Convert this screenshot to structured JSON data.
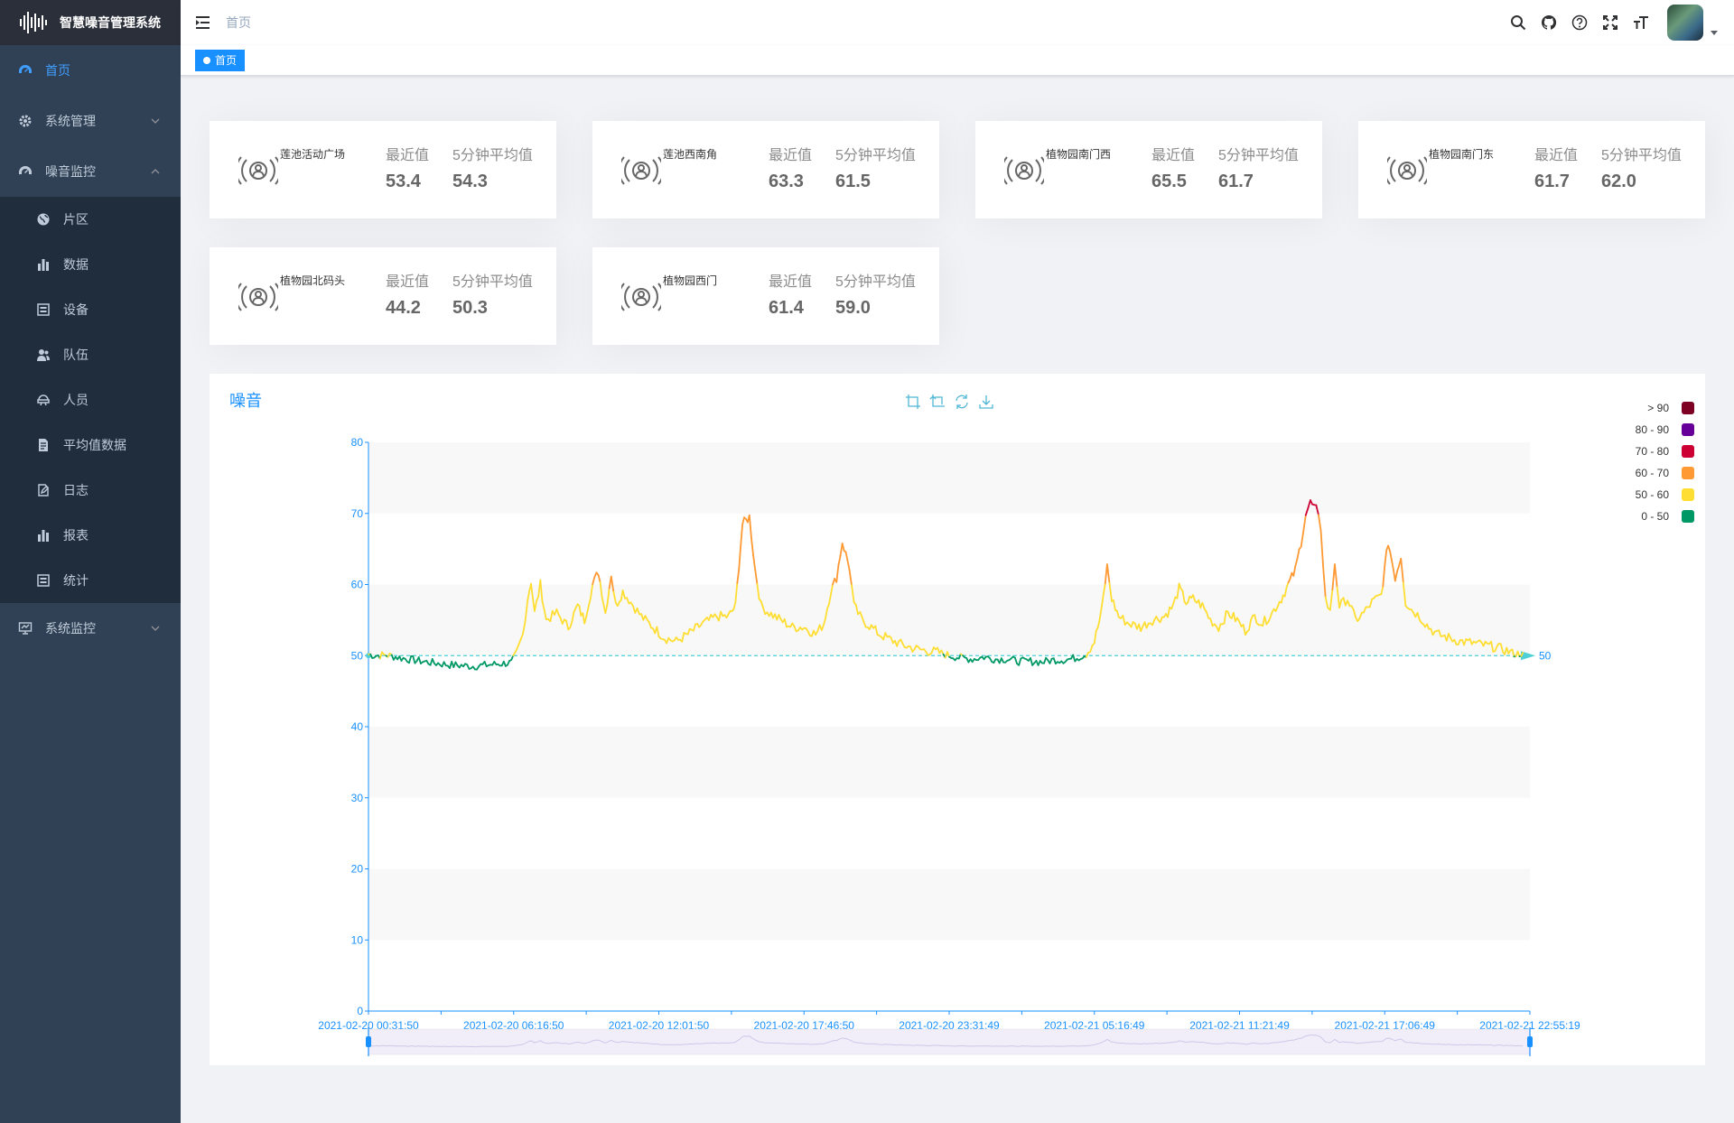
{
  "app": {
    "title": "智慧噪音管理系统"
  },
  "sidebar": {
    "items": [
      {
        "label": "首页",
        "icon": "dashboard-icon",
        "active": true
      },
      {
        "label": "系统管理",
        "icon": "gear-icon",
        "expandable": true
      },
      {
        "label": "噪音监控",
        "icon": "dashboard-icon",
        "expandable": true,
        "expanded": true
      }
    ],
    "submenu": [
      {
        "label": "片区",
        "icon": "globe-icon"
      },
      {
        "label": "数据",
        "icon": "bar-chart-icon"
      },
      {
        "label": "设备",
        "icon": "device-icon"
      },
      {
        "label": "队伍",
        "icon": "team-icon"
      },
      {
        "label": "人员",
        "icon": "person-icon"
      },
      {
        "label": "平均值数据",
        "icon": "document-icon"
      },
      {
        "label": "日志",
        "icon": "edit-icon"
      },
      {
        "label": "报表",
        "icon": "bar-chart-icon"
      },
      {
        "label": "统计",
        "icon": "device-icon"
      }
    ],
    "bottom": {
      "label": "系统监控",
      "icon": "monitor-icon"
    }
  },
  "navbar": {
    "breadcrumb": "首页"
  },
  "tags": {
    "active": "首页"
  },
  "labels": {
    "latest": "最近值",
    "avg5": "5分钟平均值"
  },
  "cards": [
    {
      "name": "莲池活动广场",
      "latest": "53.4",
      "avg": "54.3"
    },
    {
      "name": "莲池西南角",
      "latest": "63.3",
      "avg": "61.5"
    },
    {
      "name": "植物园南门西",
      "latest": "65.5",
      "avg": "61.7"
    },
    {
      "name": "植物园南门东",
      "latest": "61.7",
      "avg": "62.0"
    },
    {
      "name": "植物园北码头",
      "latest": "44.2",
      "avg": "50.3"
    },
    {
      "name": "植物园西门",
      "latest": "61.4",
      "avg": "59.0"
    }
  ],
  "colors": {
    "accent": "#1890ff",
    "sidebar_bg": "#304156",
    "sidebar_sub_bg": "#1f2d3d"
  },
  "chart_data": {
    "type": "line",
    "title": "噪音",
    "ylim": [
      0,
      80
    ],
    "yticks": [
      0,
      10,
      20,
      30,
      40,
      50,
      60,
      70,
      80
    ],
    "x_tick_labels": [
      "2021-02-20 00:31:50",
      "2021-02-20 06:16:50",
      "2021-02-20 12:01:50",
      "2021-02-20 17:46:50",
      "2021-02-20 23:31:49",
      "2021-02-21 05:16:49",
      "2021-02-21 11:21:49",
      "2021-02-21 17:06:49",
      "2021-02-21 22:55:19"
    ],
    "markline": {
      "value": 50,
      "label": "50"
    },
    "grid": "alternating-bands",
    "legend_position": "top-right",
    "pieces": [
      {
        "label": "> 90",
        "min": 90,
        "color": "#7e0023"
      },
      {
        "label": "80 - 90",
        "min": 80,
        "max": 90,
        "color": "#660099"
      },
      {
        "label": "70 - 80",
        "min": 70,
        "max": 80,
        "color": "#cc0033"
      },
      {
        "label": "60 - 70",
        "min": 60,
        "max": 70,
        "color": "#ff9933"
      },
      {
        "label": "50 - 60",
        "min": 50,
        "max": 60,
        "color": "#ffde33"
      },
      {
        "label": "0 - 50",
        "min": 0,
        "max": 50,
        "color": "#096"
      }
    ],
    "key_points": [
      [
        0,
        50.2
      ],
      [
        0.5,
        50.0
      ],
      [
        1.5,
        50.1
      ],
      [
        3,
        49.6
      ],
      [
        5,
        49.1
      ],
      [
        7,
        48.7
      ],
      [
        9,
        48.5
      ],
      [
        11,
        48.8
      ],
      [
        12.3,
        49.0
      ],
      [
        12.8,
        50.5
      ],
      [
        13.3,
        53
      ],
      [
        13.7,
        58
      ],
      [
        14.0,
        60.5
      ],
      [
        14.3,
        56
      ],
      [
        14.8,
        60
      ],
      [
        15.3,
        55
      ],
      [
        16.2,
        56
      ],
      [
        17.2,
        54
      ],
      [
        18.0,
        57
      ],
      [
        18.6,
        55
      ],
      [
        19.3,
        60
      ],
      [
        19.8,
        61.8
      ],
      [
        20.4,
        56
      ],
      [
        20.9,
        61.5
      ],
      [
        21.3,
        57
      ],
      [
        21.9,
        59
      ],
      [
        22.6,
        57.5
      ],
      [
        23.5,
        55.5
      ],
      [
        24.5,
        54
      ],
      [
        25.5,
        52.5
      ],
      [
        26.5,
        52
      ],
      [
        27.5,
        53
      ],
      [
        28.8,
        54.5
      ],
      [
        30.0,
        55.5
      ],
      [
        31.0,
        55.5
      ],
      [
        31.6,
        57
      ],
      [
        32.2,
        68.5
      ],
      [
        32.8,
        69.5
      ],
      [
        33.3,
        62
      ],
      [
        33.8,
        57
      ],
      [
        34.5,
        56
      ],
      [
        35.5,
        55
      ],
      [
        36.5,
        54
      ],
      [
        37.5,
        54
      ],
      [
        38.5,
        53
      ],
      [
        39.2,
        54.5
      ],
      [
        39.8,
        59
      ],
      [
        40.3,
        61
      ],
      [
        40.8,
        66
      ],
      [
        41.4,
        62.5
      ],
      [
        41.8,
        57
      ],
      [
        42.5,
        55
      ],
      [
        43.3,
        54
      ],
      [
        44,
        53
      ],
      [
        45,
        52.2
      ],
      [
        46,
        51.5
      ],
      [
        47,
        51
      ],
      [
        48,
        50.7
      ],
      [
        49,
        50.5
      ],
      [
        50,
        50
      ],
      [
        51,
        49.7
      ],
      [
        52,
        49.5
      ],
      [
        53,
        49.8
      ],
      [
        54,
        49.5
      ],
      [
        55,
        49.5
      ],
      [
        56,
        49.2
      ],
      [
        57,
        49.2
      ],
      [
        58,
        49.1
      ],
      [
        59,
        49.4
      ],
      [
        60,
        49.4
      ],
      [
        61,
        49.7
      ],
      [
        61.8,
        50.2
      ],
      [
        62.5,
        52
      ],
      [
        63.1,
        56
      ],
      [
        63.6,
        62.5
      ],
      [
        64.0,
        58
      ],
      [
        64.6,
        55.5
      ],
      [
        65.5,
        54.5
      ],
      [
        66.5,
        54
      ],
      [
        67.5,
        55
      ],
      [
        68.5,
        55.5
      ],
      [
        69.3,
        57
      ],
      [
        69.8,
        59.5
      ],
      [
        70.4,
        57.5
      ],
      [
        71,
        58
      ],
      [
        71.8,
        57
      ],
      [
        72.5,
        55
      ],
      [
        73.2,
        54
      ],
      [
        74,
        56
      ],
      [
        74.8,
        55
      ],
      [
        75.5,
        53.5
      ],
      [
        76.3,
        55.5
      ],
      [
        77,
        54.5
      ],
      [
        77.8,
        56
      ],
      [
        78.6,
        58
      ],
      [
        79.2,
        60
      ],
      [
        79.8,
        62
      ],
      [
        80.3,
        66
      ],
      [
        80.7,
        70
      ],
      [
        81.1,
        71.5
      ],
      [
        81.6,
        70.5
      ],
      [
        82,
        68
      ],
      [
        82.4,
        58
      ],
      [
        82.8,
        56
      ],
      [
        83.2,
        63
      ],
      [
        83.6,
        57
      ],
      [
        84.3,
        58
      ],
      [
        85,
        55
      ],
      [
        85.7,
        56
      ],
      [
        86.4,
        57.5
      ],
      [
        87.2,
        58.5
      ],
      [
        87.8,
        66
      ],
      [
        88.4,
        61
      ],
      [
        88.9,
        64
      ],
      [
        89.3,
        57.5
      ],
      [
        89.8,
        56.5
      ],
      [
        90.5,
        55.5
      ],
      [
        91.3,
        54
      ],
      [
        92,
        53
      ],
      [
        93,
        52.5
      ],
      [
        94,
        52
      ],
      [
        95,
        51.8
      ],
      [
        96,
        51.5
      ],
      [
        97,
        51.2
      ],
      [
        98,
        50.7
      ],
      [
        98.8,
        50.2
      ],
      [
        99.4,
        50.4
      ]
    ],
    "x_range": [
      0,
      100
    ]
  }
}
